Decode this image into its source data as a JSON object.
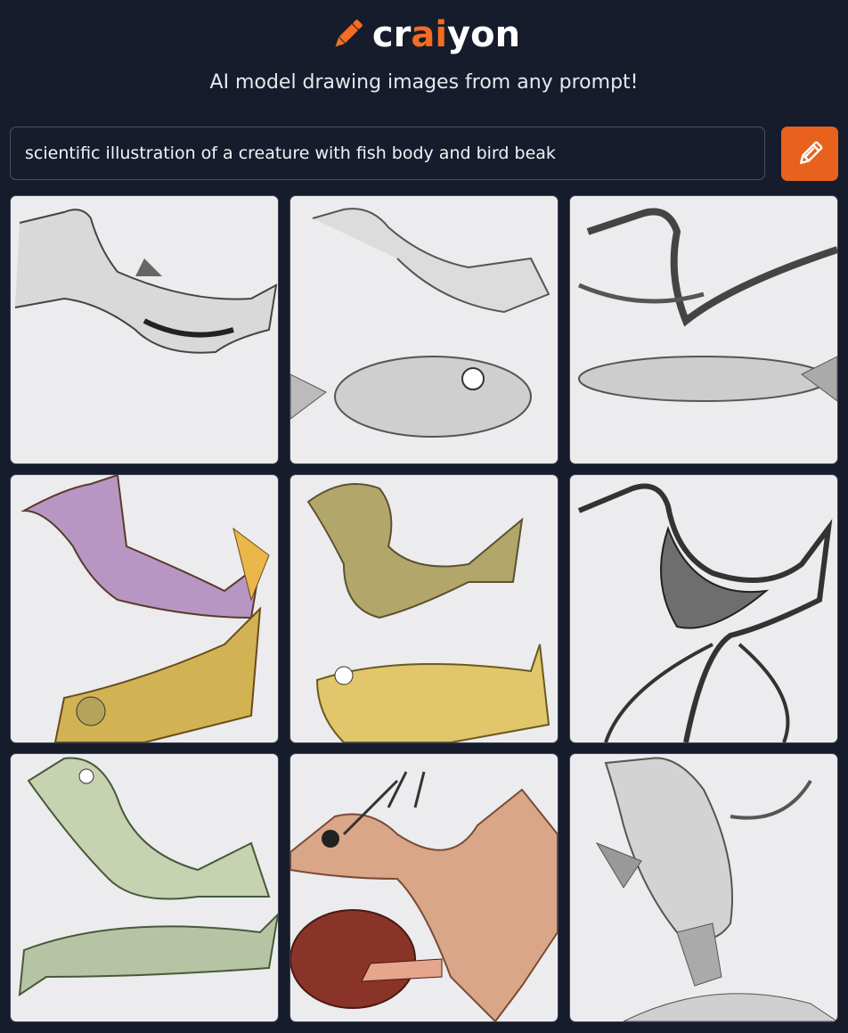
{
  "header": {
    "logo": {
      "part1": "cr",
      "part2": "ai",
      "part3": "yon"
    },
    "tagline": "AI model drawing images from any prompt!"
  },
  "prompt": {
    "value": "scientific illustration of a creature with fish body and bird beak"
  },
  "colors": {
    "background": "#161c2b",
    "accent": "#e8611d",
    "tile_bg": "#ecebed"
  },
  "icons": {
    "logo": "pencil-icon",
    "draw_button": "pencil-icon"
  },
  "results": [
    {
      "alt": "bird-fish creature drawing 1"
    },
    {
      "alt": "bird-fish creature drawing 2"
    },
    {
      "alt": "bird-fish creature drawing 3"
    },
    {
      "alt": "bird-fish creature drawing 4"
    },
    {
      "alt": "bird-fish creature drawing 5"
    },
    {
      "alt": "bird-fish creature drawing 6"
    },
    {
      "alt": "bird-fish creature drawing 7"
    },
    {
      "alt": "bird-fish creature drawing 8"
    },
    {
      "alt": "bird-fish creature drawing 9"
    }
  ]
}
